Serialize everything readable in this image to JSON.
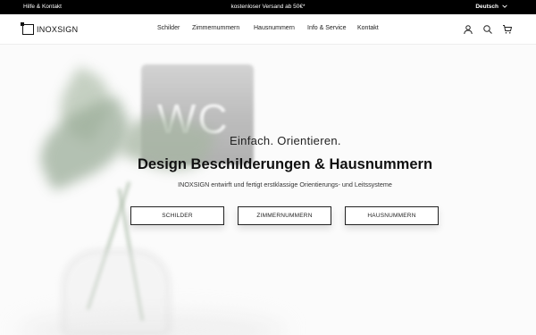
{
  "topbar": {
    "help_label": "Hilfe & Kontakt",
    "promo": "kostenloser Versand ab 50€*",
    "language": "Deutsch"
  },
  "header": {
    "logo_text": "INOXSIGN",
    "nav": [
      "Schilder",
      "Zimmernummern",
      "Hausnummern",
      "Info & Service",
      "Kontakt"
    ],
    "icons": [
      "user-icon",
      "search-icon",
      "cart-icon"
    ]
  },
  "hero": {
    "image_text": "WC",
    "tagline": "Einfach. Orientieren.",
    "headline": "Design Beschilderungen & Hausnummern",
    "subline": "INOXSIGN entwirft und fertigt erstklassige Orientierungs- und Leitssysteme",
    "buttons": [
      "SCHILDER",
      "ZIMMERNUMMERN",
      "HAUSNUMMERN"
    ]
  },
  "colors": {
    "topbar_bg": "#000000",
    "text": "#222222",
    "hero_bg": "#fbfbfb"
  }
}
